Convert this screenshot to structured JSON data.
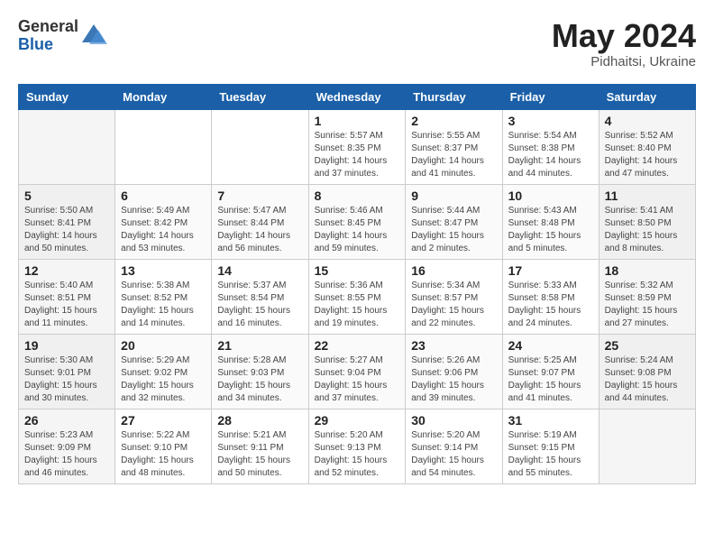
{
  "header": {
    "logo_general": "General",
    "logo_blue": "Blue",
    "month_year": "May 2024",
    "location": "Pidhaitsi, Ukraine"
  },
  "days_of_week": [
    "Sunday",
    "Monday",
    "Tuesday",
    "Wednesday",
    "Thursday",
    "Friday",
    "Saturday"
  ],
  "weeks": [
    [
      {
        "day": "",
        "info": ""
      },
      {
        "day": "",
        "info": ""
      },
      {
        "day": "",
        "info": ""
      },
      {
        "day": "1",
        "info": "Sunrise: 5:57 AM\nSunset: 8:35 PM\nDaylight: 14 hours\nand 37 minutes."
      },
      {
        "day": "2",
        "info": "Sunrise: 5:55 AM\nSunset: 8:37 PM\nDaylight: 14 hours\nand 41 minutes."
      },
      {
        "day": "3",
        "info": "Sunrise: 5:54 AM\nSunset: 8:38 PM\nDaylight: 14 hours\nand 44 minutes."
      },
      {
        "day": "4",
        "info": "Sunrise: 5:52 AM\nSunset: 8:40 PM\nDaylight: 14 hours\nand 47 minutes."
      }
    ],
    [
      {
        "day": "5",
        "info": "Sunrise: 5:50 AM\nSunset: 8:41 PM\nDaylight: 14 hours\nand 50 minutes."
      },
      {
        "day": "6",
        "info": "Sunrise: 5:49 AM\nSunset: 8:42 PM\nDaylight: 14 hours\nand 53 minutes."
      },
      {
        "day": "7",
        "info": "Sunrise: 5:47 AM\nSunset: 8:44 PM\nDaylight: 14 hours\nand 56 minutes."
      },
      {
        "day": "8",
        "info": "Sunrise: 5:46 AM\nSunset: 8:45 PM\nDaylight: 14 hours\nand 59 minutes."
      },
      {
        "day": "9",
        "info": "Sunrise: 5:44 AM\nSunset: 8:47 PM\nDaylight: 15 hours\nand 2 minutes."
      },
      {
        "day": "10",
        "info": "Sunrise: 5:43 AM\nSunset: 8:48 PM\nDaylight: 15 hours\nand 5 minutes."
      },
      {
        "day": "11",
        "info": "Sunrise: 5:41 AM\nSunset: 8:50 PM\nDaylight: 15 hours\nand 8 minutes."
      }
    ],
    [
      {
        "day": "12",
        "info": "Sunrise: 5:40 AM\nSunset: 8:51 PM\nDaylight: 15 hours\nand 11 minutes."
      },
      {
        "day": "13",
        "info": "Sunrise: 5:38 AM\nSunset: 8:52 PM\nDaylight: 15 hours\nand 14 minutes."
      },
      {
        "day": "14",
        "info": "Sunrise: 5:37 AM\nSunset: 8:54 PM\nDaylight: 15 hours\nand 16 minutes."
      },
      {
        "day": "15",
        "info": "Sunrise: 5:36 AM\nSunset: 8:55 PM\nDaylight: 15 hours\nand 19 minutes."
      },
      {
        "day": "16",
        "info": "Sunrise: 5:34 AM\nSunset: 8:57 PM\nDaylight: 15 hours\nand 22 minutes."
      },
      {
        "day": "17",
        "info": "Sunrise: 5:33 AM\nSunset: 8:58 PM\nDaylight: 15 hours\nand 24 minutes."
      },
      {
        "day": "18",
        "info": "Sunrise: 5:32 AM\nSunset: 8:59 PM\nDaylight: 15 hours\nand 27 minutes."
      }
    ],
    [
      {
        "day": "19",
        "info": "Sunrise: 5:30 AM\nSunset: 9:01 PM\nDaylight: 15 hours\nand 30 minutes."
      },
      {
        "day": "20",
        "info": "Sunrise: 5:29 AM\nSunset: 9:02 PM\nDaylight: 15 hours\nand 32 minutes."
      },
      {
        "day": "21",
        "info": "Sunrise: 5:28 AM\nSunset: 9:03 PM\nDaylight: 15 hours\nand 34 minutes."
      },
      {
        "day": "22",
        "info": "Sunrise: 5:27 AM\nSunset: 9:04 PM\nDaylight: 15 hours\nand 37 minutes."
      },
      {
        "day": "23",
        "info": "Sunrise: 5:26 AM\nSunset: 9:06 PM\nDaylight: 15 hours\nand 39 minutes."
      },
      {
        "day": "24",
        "info": "Sunrise: 5:25 AM\nSunset: 9:07 PM\nDaylight: 15 hours\nand 41 minutes."
      },
      {
        "day": "25",
        "info": "Sunrise: 5:24 AM\nSunset: 9:08 PM\nDaylight: 15 hours\nand 44 minutes."
      }
    ],
    [
      {
        "day": "26",
        "info": "Sunrise: 5:23 AM\nSunset: 9:09 PM\nDaylight: 15 hours\nand 46 minutes."
      },
      {
        "day": "27",
        "info": "Sunrise: 5:22 AM\nSunset: 9:10 PM\nDaylight: 15 hours\nand 48 minutes."
      },
      {
        "day": "28",
        "info": "Sunrise: 5:21 AM\nSunset: 9:11 PM\nDaylight: 15 hours\nand 50 minutes."
      },
      {
        "day": "29",
        "info": "Sunrise: 5:20 AM\nSunset: 9:13 PM\nDaylight: 15 hours\nand 52 minutes."
      },
      {
        "day": "30",
        "info": "Sunrise: 5:20 AM\nSunset: 9:14 PM\nDaylight: 15 hours\nand 54 minutes."
      },
      {
        "day": "31",
        "info": "Sunrise: 5:19 AM\nSunset: 9:15 PM\nDaylight: 15 hours\nand 55 minutes."
      },
      {
        "day": "",
        "info": ""
      }
    ]
  ]
}
